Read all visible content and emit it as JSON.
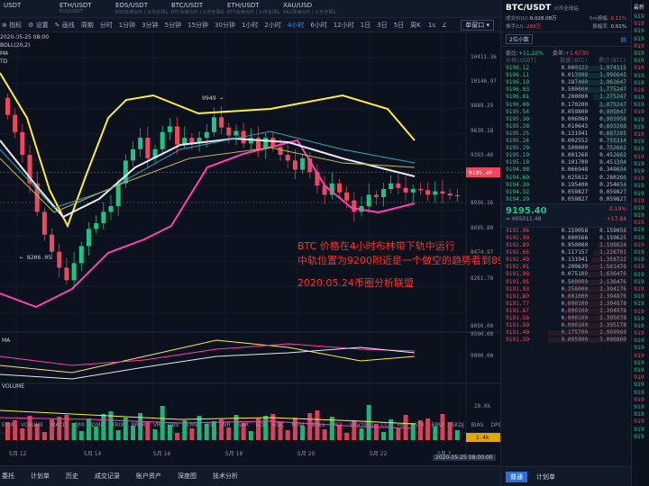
{
  "top_tabs": [
    {
      "name": "USDT",
      "sub": ""
    },
    {
      "name": "ETH/USDT",
      "sub": "EOS/USDT"
    },
    {
      "name": "EOS/USDT",
      "sub": "EOS永续合约 | 火币全球站"
    },
    {
      "name": "BTC/USDT",
      "sub": "BTC永续合约 | 火币全球站"
    },
    {
      "name": "ETH/USDT",
      "sub": "ETH永续合约 | 火币全球站"
    },
    {
      "name": "XAU/USD",
      "sub": "XAU永续合约 | 火币全球站"
    }
  ],
  "toolbar": {
    "indicator": "指标",
    "settings": "设置",
    "draw": "画线",
    "periods": [
      "周期",
      "分时",
      "1分钟",
      "3分钟",
      "5分钟",
      "15分钟",
      "30分钟",
      "1小时",
      "2小时",
      "4小时",
      "6小时",
      "12小时",
      "1日",
      "3日",
      "5日",
      "周K"
    ],
    "active_period": "4小时",
    "r1": "1s",
    "r2": "∠",
    "view": "单窗口"
  },
  "indicators": {
    "date": "2020-05-25 08:00",
    "boll": "BOLL(20,2)",
    "ma": "MA",
    "td": "TD",
    "vol": "VOLUME",
    "ma2": "MA"
  },
  "annotations": {
    "high": "9949",
    "low": "8206.05",
    "line1": "BTC 价格在4小时布林带下轨中运行",
    "line2": "中轨位置为9200附近是一个做空的趋势看到8900附近",
    "line3": "2020.05.24币圈分析联盟"
  },
  "price_axis": [
    "10411.36",
    "10146.97",
    "9889.29",
    "9638.18",
    "9393.40",
    "9195.40",
    "8936.16",
    "8695.80",
    "8474.97",
    "8261.70",
    "8050.00"
  ],
  "price_tag": "9195.40",
  "sub_axis": [
    "9500.00",
    "9000.00"
  ],
  "vol_axis": [
    "20.0k",
    "1.4k"
  ],
  "date_axis": [
    "5月 12",
    "5月 14",
    "5月 16",
    "5月 18",
    "5月 20",
    "5月 22",
    "5月 2"
  ],
  "time_label": "2020-05-25 08:00:00",
  "ind_bar": [
    "EMA",
    "VOLUME",
    "MACD",
    "DMI",
    "DMA",
    "TRIX",
    "BRAR",
    "VR",
    "OBV",
    "EMV",
    "RSI",
    "WR",
    "SAR",
    "KDJ",
    "ROC",
    "MTM",
    "BOLL",
    "PSY",
    "StochRSI",
    "CCI",
    "MFI",
    "ATR",
    "BBW",
    "SKDJ",
    "BIAS",
    "DPO",
    "AO"
  ],
  "footer": [
    "委托",
    "计划单",
    "历史",
    "成交记录",
    "账户资产",
    "深度图",
    "技术分析"
  ],
  "header": {
    "pair": "BTC/USDT",
    "exch": "火币全球站",
    "close_lbl": "成交价(U):",
    "close": "9,028.08万",
    "change": "-0.11%",
    "volume_lbl": "换手(U):",
    "volume": "-283万",
    "turnover_lbl": "振幅率:",
    "turnover": "0.01%",
    "range_lbl": "5m振幅",
    "depth": "2位小数",
    "buy_lbl": "委比:",
    "buy": "+11.22%",
    "sell_lbl": "委差:",
    "sell": "+1.6730"
  },
  "cols": {
    "price": "价格(USDT)",
    "qty": "数量(BTC)",
    "cum": "累计(BTC)"
  },
  "asks": [
    [
      "9196.12",
      "0.000123",
      "1.974115"
    ],
    [
      "9196.11",
      "0.013998",
      "1.996645"
    ],
    [
      "9196.10",
      "0.187400",
      "1.962647"
    ],
    [
      "9196.03",
      "0.500000",
      "1.775247"
    ],
    [
      "9196.01",
      "0.200000",
      "1.275247"
    ],
    [
      "9196.00",
      "0.170200",
      "1.075247"
    ],
    [
      "9195.54",
      "0.059800",
      "0.905047"
    ],
    [
      "9195.30",
      "0.006060",
      "0.903958"
    ],
    [
      "9195.28",
      "0.010643",
      "0.893268"
    ],
    [
      "9195.25",
      "0.131941",
      "0.887285"
    ],
    [
      "9195.24",
      "0.002552",
      "0.755314"
    ],
    [
      "9195.20",
      "0.500000",
      "0.752662"
    ],
    [
      "9195.19",
      "0.001268",
      "0.452662"
    ],
    [
      "9195.18",
      "0.101700",
      "0.451394"
    ],
    [
      "9194.98",
      "0.066948",
      "0.349694"
    ],
    [
      "9194.69",
      "0.025612",
      "0.280266"
    ],
    [
      "9194.30",
      "0.195400",
      "0.254654"
    ],
    [
      "9194.32",
      "0.059827",
      "0.059827"
    ],
    [
      "9194.29",
      "0.059827",
      "0.059827"
    ]
  ],
  "mid": {
    "price": "9195.40",
    "pct": "0.19%",
    "cny": "≈ ¥65011.48",
    "chg": "+17.84"
  },
  "bids": [
    [
      "9192.96",
      "0.159058",
      "0.159058"
    ],
    [
      "9192.90",
      "0.000566",
      "0.159625"
    ],
    [
      "9192.89",
      "0.950000",
      "1.109624"
    ],
    [
      "9192.66",
      "0.117157",
      "1.226781"
    ],
    [
      "9192.40",
      "0.131941",
      "1.358722"
    ],
    [
      "9192.01",
      "0.200639",
      "1.561476"
    ],
    [
      "9191.98",
      "0.075100",
      "1.636476"
    ],
    [
      "9191.95",
      "0.500000",
      "2.136476"
    ],
    [
      "9191.93",
      "0.258000",
      "2.394176"
    ],
    [
      "9191.80",
      "0.001000",
      "2.394876"
    ],
    [
      "9191.77",
      "0.000100",
      "2.394878"
    ],
    [
      "9191.67",
      "0.000100",
      "2.394978"
    ],
    [
      "9191.56",
      "0.000100",
      "2.395078"
    ],
    [
      "9191.50",
      "0.000100",
      "2.395178"
    ],
    [
      "9191.40",
      "0.175700",
      "2.999960"
    ],
    [
      "9191.39",
      "0.095900",
      "3.000860"
    ]
  ],
  "right_footer": {
    "a": "普通",
    "b": "计划单"
  },
  "far": {
    "title": "最新",
    "prices": [
      "919",
      "919",
      "919",
      "919",
      "919",
      "919",
      "919",
      "919",
      "919",
      "919",
      "919",
      "919",
      "919",
      "919",
      "919",
      "919",
      "919",
      "919",
      "919",
      "919",
      "919",
      "919",
      "919",
      "919",
      "919",
      "919",
      "919",
      "919",
      "919",
      "919",
      "919",
      "919",
      "919",
      "919",
      "919",
      "919",
      "919",
      "919",
      "919",
      "919",
      "919",
      "919",
      "919",
      "919",
      "919",
      "919",
      "919",
      "919",
      "919",
      "919",
      "919",
      "919",
      "919",
      "919",
      "919",
      "919",
      "919",
      "919"
    ]
  }
}
